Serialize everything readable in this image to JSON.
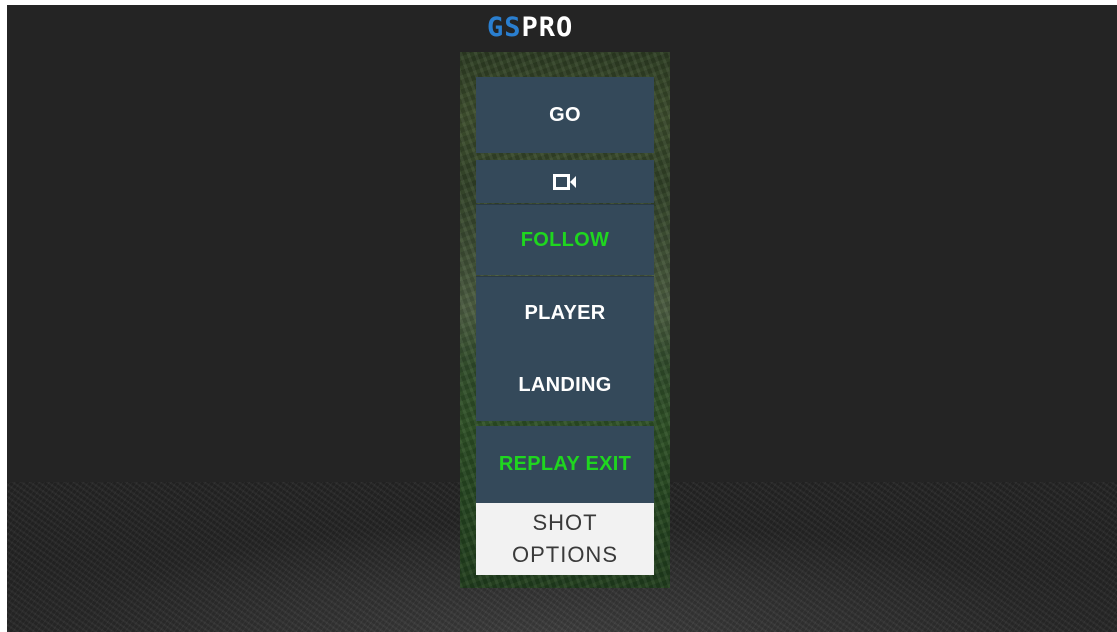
{
  "logo": {
    "part1": "GS",
    "part2": "PRO",
    "accent_color": "#2a7fd0"
  },
  "menu": {
    "go_label": "GO",
    "camera_icon": "video-camera-icon",
    "follow_label": "FOLLOW",
    "player_label": "PLAYER",
    "landing_label": "LANDING",
    "replay_exit_label": "REPLAY EXIT",
    "shot_options_line1": "SHOT",
    "shot_options_line2": "OPTIONS",
    "active_color": "#1fd61f",
    "button_color": "#34495a"
  }
}
